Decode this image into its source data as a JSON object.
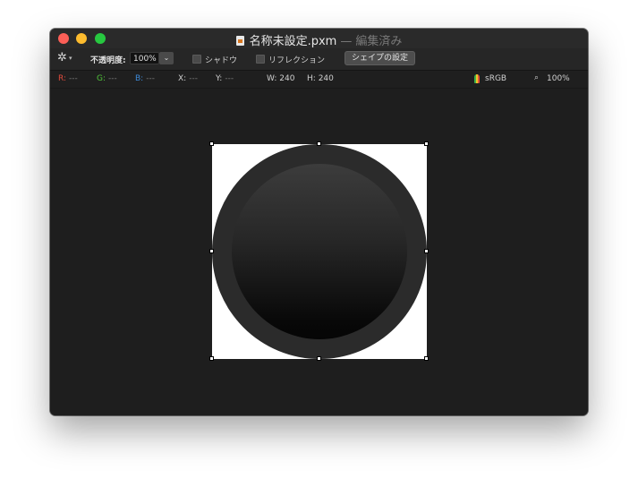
{
  "window": {
    "title": "名称未設定.pxm",
    "separator": "—",
    "edited_status": "編集済み"
  },
  "toolbar": {
    "settings_icon": "gear-icon",
    "opacity_label": "不透明度:",
    "opacity_value": "100%",
    "shadow_label": "シャドウ",
    "reflection_label": "リフレクション",
    "shape_settings_label": "シェイプの設定"
  },
  "infobar": {
    "r_label": "R:",
    "r_value": "---",
    "g_label": "G:",
    "g_value": "---",
    "b_label": "B:",
    "b_value": "---",
    "x_label": "X:",
    "x_value": "---",
    "y_label": "Y:",
    "y_value": "---",
    "w_label": "W:",
    "w_value": "240",
    "h_label": "H:",
    "h_value": "240",
    "color_profile": "sRGB",
    "zoom": "100%"
  },
  "colors": {
    "close": "#fc5f57",
    "minimize": "#fdbc2e",
    "maximize": "#27c840",
    "r_label": "#e04b3c",
    "g_label": "#51c33a",
    "b_label": "#3d8ad8"
  }
}
